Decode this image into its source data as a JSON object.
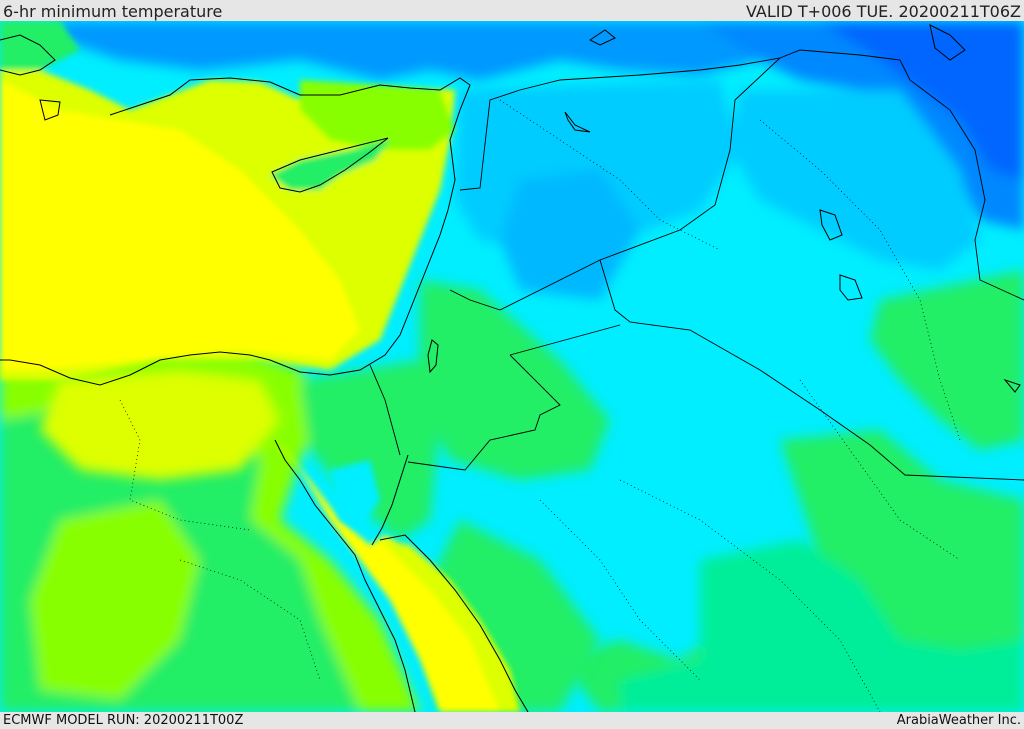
{
  "header": {
    "title": "6-hr minimum temperature",
    "valid": "VALID T+006 TUE. 20200211T06Z"
  },
  "footer": {
    "model_run": "ECMWF MODEL RUN: 20200211T00Z",
    "credit": "ArabiaWeather Inc."
  },
  "colors": {
    "yellow": "#ffff00",
    "yellow_green": "#ddff00",
    "light_green": "#88ff00",
    "green": "#22ee66",
    "teal": "#00ee99",
    "cyan": "#00eeff",
    "light_blue": "#00ccff",
    "blue": "#0099ff",
    "deep_blue": "#0066ff",
    "border": "#000000"
  }
}
